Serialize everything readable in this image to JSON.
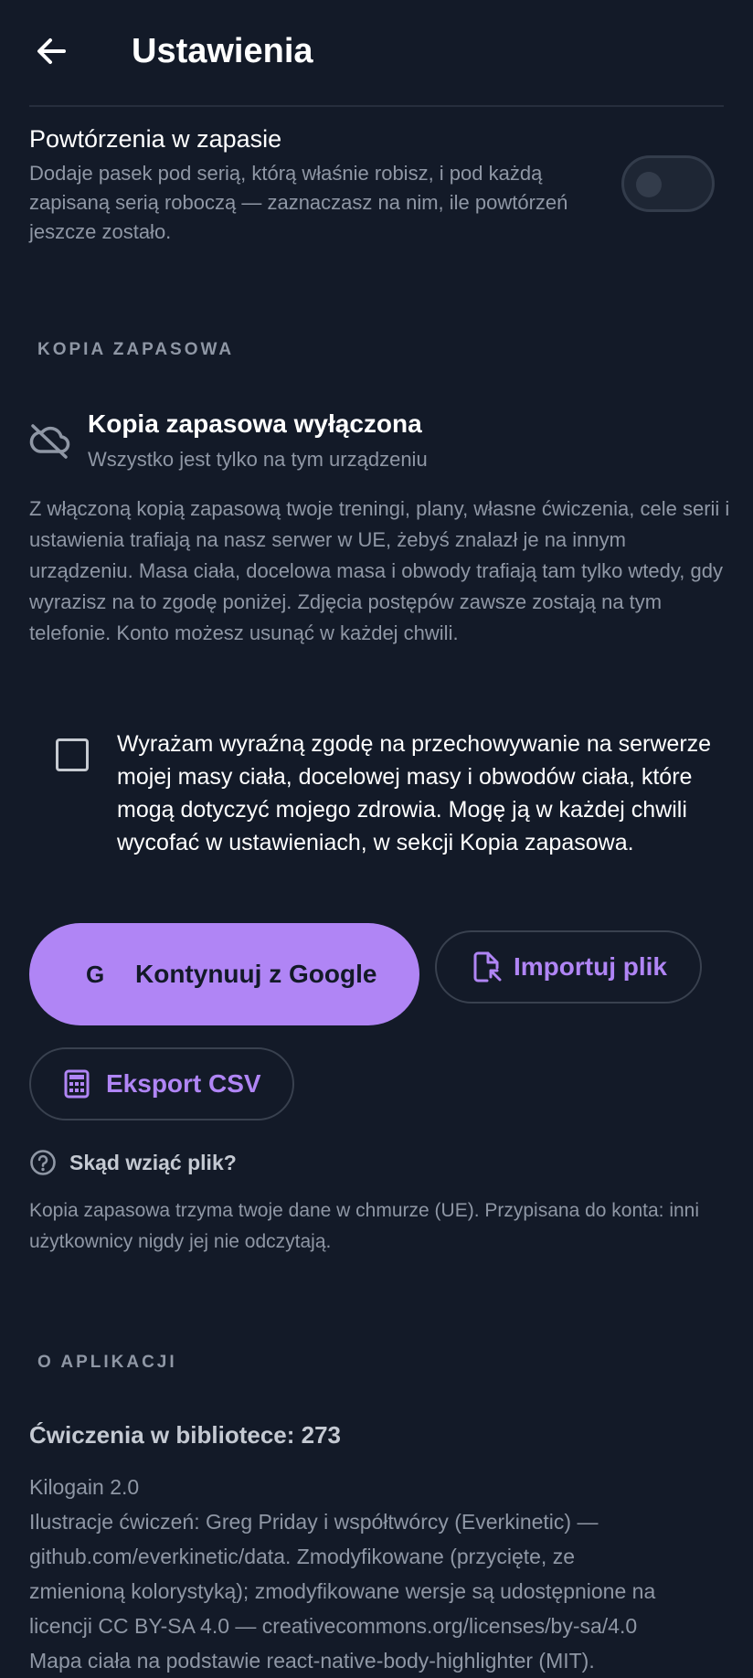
{
  "header": {
    "title": "Ustawienia"
  },
  "reserve_reps": {
    "title": "Powtórzenia w zapasie",
    "description": "Dodaje pasek pod serią, którą właśnie robisz, i pod każdą zapisaną serią roboczą — zaznaczasz na nim, ile powtórzeń jeszcze zostało.",
    "enabled": false
  },
  "backup": {
    "section_label": "KOPIA ZAPASOWA",
    "status_title": "Kopia zapasowa wyłączona",
    "status_subtitle": "Wszystko jest tylko na tym urządzeniu",
    "description": "Z włączoną kopią zapasową twoje treningi, plany, własne ćwiczenia, cele serii i ustawienia trafiają na nasz serwer w UE, żebyś znalazł je na innym urządzeniu. Masa ciała, docelowa masa i obwody trafiają tam tylko wtedy, gdy wyrazisz na to zgodę poniżej. Zdjęcia postępów zawsze zostają na tym telefonie. Konto możesz usunąć w każdej chwili.",
    "consent_text": "Wyrażam wyraźną zgodę na przechowywanie na serwerze mojej masy ciała, docelowej masy i obwodów ciała, które mogą dotyczyć mojego zdrowia. Mogę ją w każdej chwili wycofać w ustawieniach, w sekcji Kopia zapasowa.",
    "consent_checked": false,
    "google_letter": "G",
    "google_label": "Kontynuuj z Google",
    "import_label": "Importuj plik",
    "export_label": "Eksport CSV",
    "help_label": "Skąd wziąć plik?",
    "help_description": "Kopia zapasowa trzyma twoje dane w chmurze (UE). Przypisana do konta: inni użytkownicy nigdy jej nie odczytają."
  },
  "about": {
    "section_label": "O APLIKACJI",
    "exercise_count": "Ćwiczenia w bibliotece: 273",
    "lines": [
      "Kilogain 2.0",
      "Ilustracje ćwiczeń: Greg Priday i współtwórcy (Everkinetic) —",
      "github.com/everkinetic/data. Zmodyfikowane (przycięte, ze",
      "zmienioną kolorystyką); zmodyfikowane wersje są udostępnione na",
      "licencji CC BY-SA 4.0 — creativecommons.org/licenses/by-sa/4.0",
      "Mapa ciała na podstawie react-native-body-highlighter (MIT)."
    ]
  },
  "icons": {
    "back": "arrow-left-icon",
    "cloud_off": "cloud-off-icon",
    "file_import": "file-import-icon",
    "spreadsheet": "spreadsheet-icon",
    "help": "help-circle-icon"
  },
  "colors": {
    "background": "#131a28",
    "accent": "#b085f5",
    "text_primary": "#ffffff",
    "text_secondary": "#8f97a5",
    "divider": "#262e3d"
  }
}
